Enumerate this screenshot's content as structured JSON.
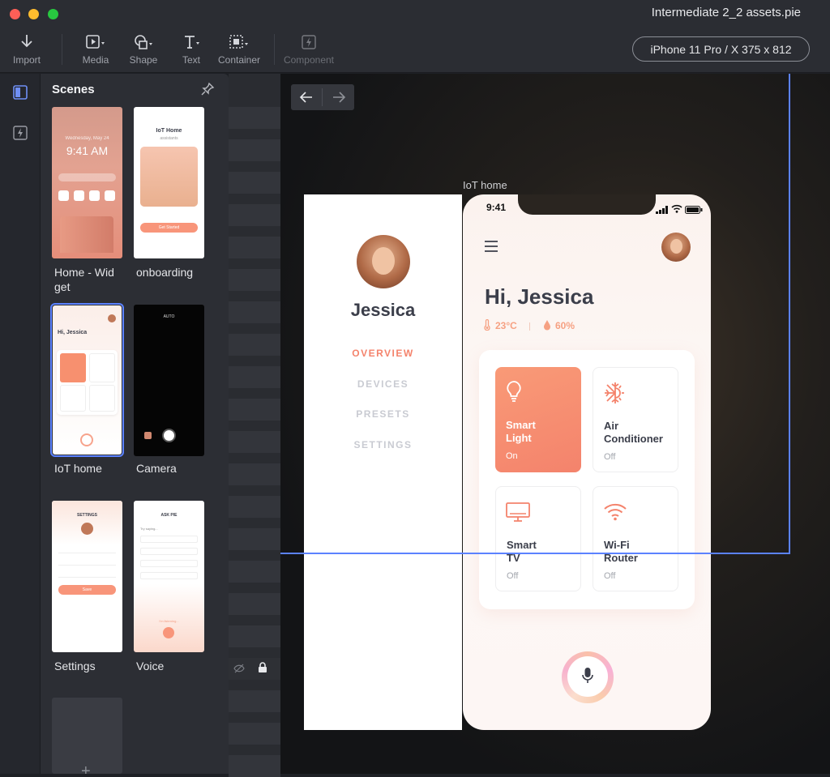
{
  "window": {
    "title": "Intermediate 2_2 assets.pie"
  },
  "toolbar": {
    "import": "Import",
    "media": "Media",
    "shape": "Shape",
    "text": "Text",
    "container": "Container",
    "component": "Component",
    "device": "iPhone 11 Pro / X  375 x 812"
  },
  "scenes": {
    "title": "Scenes",
    "items": [
      {
        "label": "Home - Wid\nget"
      },
      {
        "label": "onboarding"
      },
      {
        "label": "IoT home"
      },
      {
        "label": "Camera"
      },
      {
        "label": "Settings"
      },
      {
        "label": "Voice"
      }
    ],
    "thumbs": {
      "home_time": "9:41 AM",
      "home_date": "Wednesday, May 24",
      "onb_title": "IoT Home",
      "onb_sub": "assistants",
      "onb_btn": "Get Started",
      "iot_greeting": "Hi, Jessica",
      "camera_auto": "AUTO",
      "settings_title": "SETTINGS",
      "settings_save": "Save",
      "voice_title": "ASK PIE",
      "voice_try": "Try saying...",
      "voice_listen": "I'm listening..."
    }
  },
  "canvas": {
    "frame_label": "IoT home",
    "sidemenu": {
      "name": "Jessica",
      "items": [
        "OVERVIEW",
        "DEVICES",
        "PRESETS",
        "SETTINGS"
      ]
    },
    "phone": {
      "time": "9:41",
      "greeting": "Hi, Jessica",
      "temperature": "23°C",
      "humidity": "60%",
      "devices": [
        {
          "name": "Smart\nLight",
          "state": "On",
          "icon": "lightbulb-icon"
        },
        {
          "name": "Air\nConditioner",
          "state": "Off",
          "icon": "snowflake-sun-icon"
        },
        {
          "name": "Smart\nTV",
          "state": "Off",
          "icon": "tv-icon"
        },
        {
          "name": "Wi-Fi\nRouter",
          "state": "Off",
          "icon": "wifi-icon"
        }
      ]
    }
  },
  "colors": {
    "accent": "#f4836c",
    "selection": "#5b82ff",
    "text_dark": "#3b3e4a"
  }
}
